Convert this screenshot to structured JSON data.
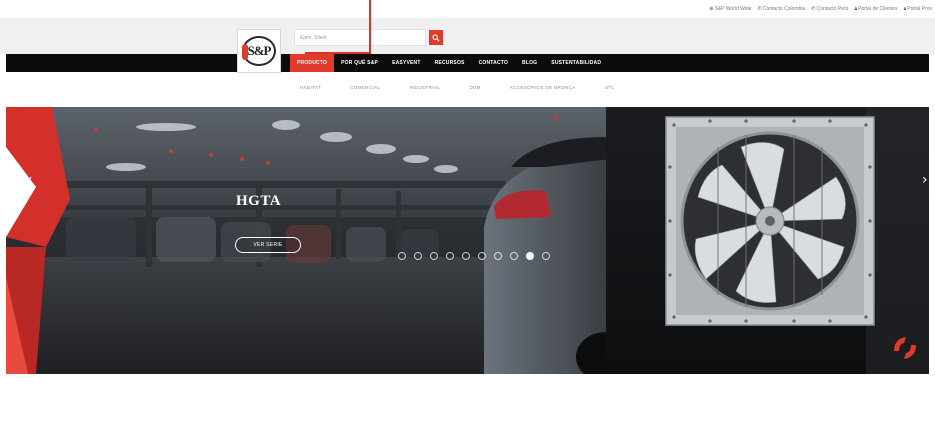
{
  "utility_links": [
    {
      "icon": "globe-icon",
      "glyph": "⊕",
      "label": "S&P World Wide"
    },
    {
      "icon": "phone-icon",
      "glyph": "✆",
      "label": "Contacto Colombia"
    },
    {
      "icon": "phone-icon",
      "glyph": "✆",
      "label": "Contacto Perú"
    },
    {
      "icon": "lock-icon",
      "glyph": "🔒︎",
      "label": "Portal de Clientes"
    },
    {
      "icon": "lock-icon",
      "glyph": "🔒︎",
      "label": "Portal Prov"
    }
  ],
  "logo": {
    "text": "S&P"
  },
  "search": {
    "placeholder": "Ejem. Silent"
  },
  "nav": [
    {
      "label": "PRODUCTO",
      "active": true
    },
    {
      "label": "POR QUÉ S&P",
      "active": false
    },
    {
      "label": "EASYVENT",
      "active": false
    },
    {
      "label": "RECURSOS",
      "active": false
    },
    {
      "label": "CONTACTO",
      "active": false
    },
    {
      "label": "BLOG",
      "active": false
    },
    {
      "label": "SUSTENTABILIDAD",
      "active": false
    }
  ],
  "subnav": [
    "HÁBITAT",
    "COMERCIAL",
    "INDUSTRIAL",
    "OEM",
    "ACCESORIOS DE BRONCA",
    "UTL"
  ],
  "hero": {
    "title": "HGTA",
    "button_label": "VER SERIE",
    "slides_count": 10,
    "active_slide": 8
  },
  "colors": {
    "accent": "#e03a2c",
    "nav_bg": "#0c0c0c",
    "header_bg": "#f0f0f0"
  }
}
